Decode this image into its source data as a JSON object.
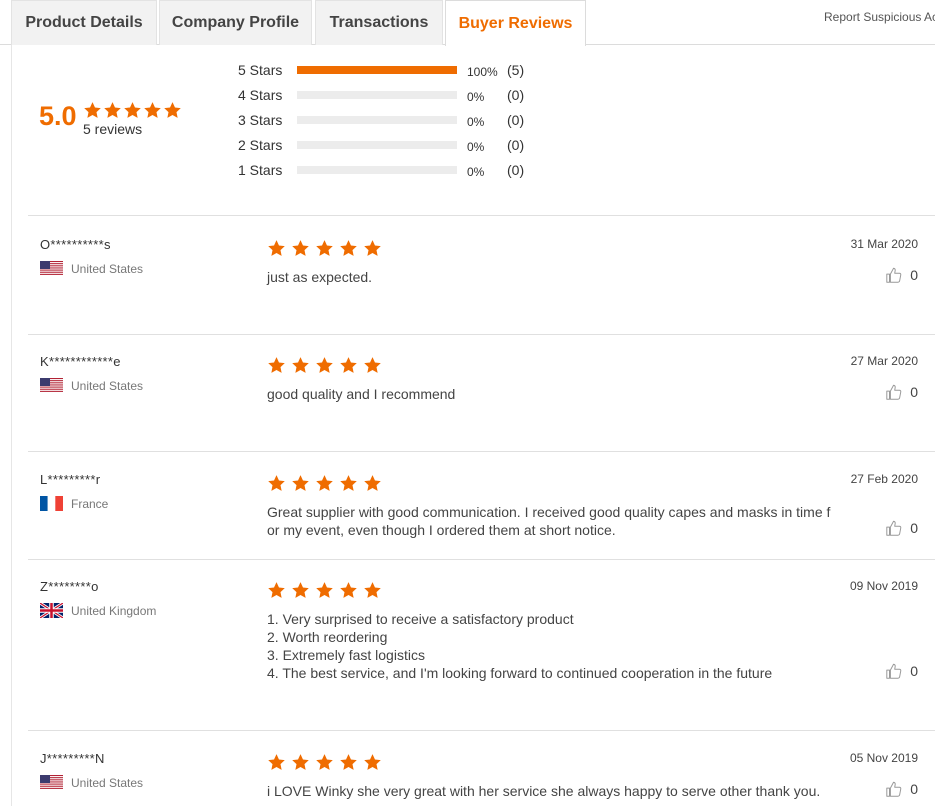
{
  "tabs": [
    {
      "label": "Product Details",
      "active": false
    },
    {
      "label": "Company Profile",
      "active": false
    },
    {
      "label": "Transactions",
      "active": false
    },
    {
      "label": "Buyer Reviews",
      "active": true
    }
  ],
  "report_link": "Report Suspicious Ac",
  "summary": {
    "score": "5.0",
    "reviews_count": "5 reviews",
    "stars": 5,
    "distribution": [
      {
        "label": "5  Stars",
        "percent": "100%",
        "fraction": 1.0,
        "count": "(5)"
      },
      {
        "label": "4  Stars",
        "percent": "0%",
        "fraction": 0,
        "count": "(0)"
      },
      {
        "label": "3  Stars",
        "percent": "0%",
        "fraction": 0,
        "count": "(0)"
      },
      {
        "label": "2  Stars",
        "percent": "0%",
        "fraction": 0,
        "count": "(0)"
      },
      {
        "label": "1  Stars",
        "percent": "0%",
        "fraction": 0,
        "count": "(0)"
      }
    ]
  },
  "reviews": [
    {
      "name": "O**********s",
      "country": "United States",
      "flag": "us-flag",
      "stars": 5,
      "text": [
        "just as expected."
      ],
      "date": "31 Mar 2020",
      "likes": "0"
    },
    {
      "name": "K************e",
      "country": "United States",
      "flag": "us-flag",
      "stars": 5,
      "text": [
        "good quality and  I recommend"
      ],
      "date": "27 Mar 2020",
      "likes": "0"
    },
    {
      "name": "L*********r",
      "country": "France",
      "flag": "fr-flag",
      "stars": 5,
      "text": [
        "Great supplier with good communication. I received good quality capes and masks in  time f",
        "or my event,  even though I ordered them at short notice."
      ],
      "date": "27 Feb 2020",
      "likes": "0"
    },
    {
      "name": "Z********o",
      "country": "United Kingdom",
      "flag": "uk-flag",
      "stars": 5,
      "text": [
        "1. Very surprised to receive a satisfactory product",
        "2. Worth reordering",
        "3. Extremely fast logistics",
        "4. The best service, and I'm looking forward to continued cooperation in the future"
      ],
      "date": "09 Nov 2019",
      "likes": "0"
    },
    {
      "name": "J*********N",
      "country": "United States",
      "flag": "us-flag",
      "stars": 5,
      "text": [
        "i LOVE Winky she very great with her service she always happy to serve other thank you."
      ],
      "date": "05 Nov 2019",
      "likes": "0"
    }
  ],
  "colors": {
    "accent": "#ef6c00",
    "bar_track": "#ececec"
  }
}
